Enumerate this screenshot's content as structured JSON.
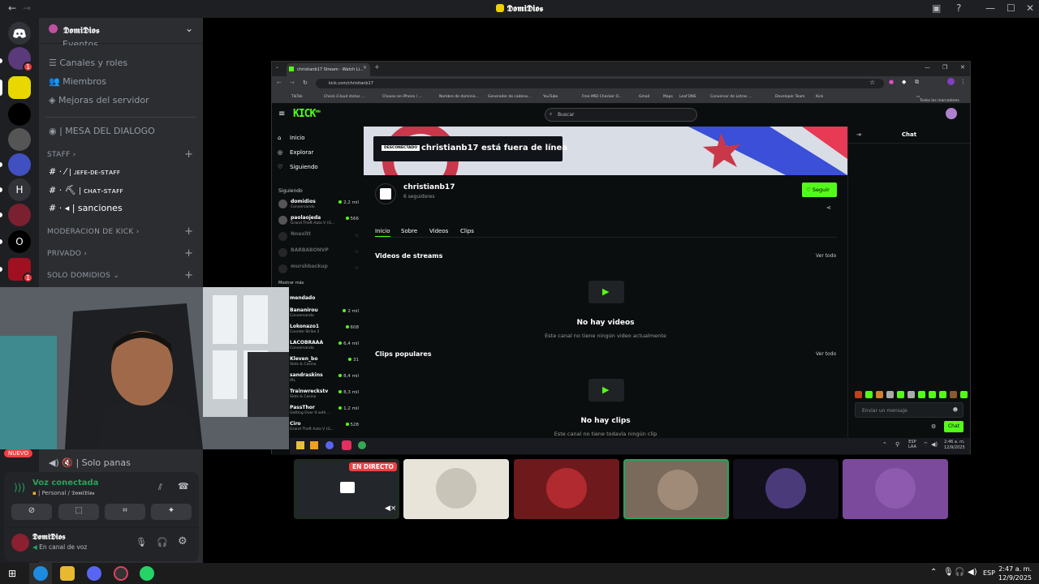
{
  "window": {
    "title": "𝕯𝖔𝖒𝖎𝕯𝖎𝖔𝖘"
  },
  "guild": {
    "name": "𝕯𝖔𝖒𝖎𝕯𝖎𝖔𝖘"
  },
  "channels": {
    "events": "Eventos",
    "roles": "Canales y roles",
    "members": "Miembros",
    "improve": "Mejoras del servidor",
    "mesa": "| MESA DEL DIALOGO",
    "cat_staff": "STAFF",
    "jefe": "| ᴊᴇꜰᴇ-ᴅᴇ-ꜱᴛᴀꜰꜰ",
    "chatstaff": "| ᴄʜᴀᴛ-ꜱᴛᴀꜰꜰ",
    "sanciones": "| sanciones",
    "cat_mod": "MODERACION DE KICK",
    "cat_priv": "PRIVADO",
    "cat_solo": "SOLO DOMIDIOS",
    "nuevo": "NUEVO",
    "solo_panas": "| Solo panas"
  },
  "servers": {
    "h": "H",
    "o": "O",
    "badge": "1"
  },
  "voice": {
    "status": "Voz conectada",
    "channel": "| Personal / 𝕯𝖔𝖒𝖎𝕯𝖎𝖔𝖘"
  },
  "user": {
    "name": "𝕯𝖔𝖒𝖎𝕯𝖎𝖔𝖘",
    "status": "En canal de voz"
  },
  "browser": {
    "tab": "christianb17 Stream - Watch Li...",
    "url": "kick.com/christianb17",
    "bookmarks": [
      "TikTok",
      "Check iCloud status ...",
      "Choose an iPhone / ...",
      "Nombre de dominio...",
      "Generador de cadena...",
      "YouTube",
      "Free IMEI Checker O...",
      "Gmail",
      "Maps",
      "Leaf DNS",
      "Conversor de Letras ...",
      "Developer Team",
      "Kick"
    ],
    "all_bookmarks": "Todos los marcadores"
  },
  "kick": {
    "logo": "KICK",
    "beta": "beta",
    "search": "Buscar",
    "nav": {
      "home": "Inicio",
      "explore": "Explorar",
      "following": "Siguiendo"
    },
    "following_header": "Siguiendo",
    "show_more": "Mostrar más",
    "recommended": "mendado",
    "followed": [
      {
        "name": "domidios",
        "game": "Conversando",
        "viewers": "2,2 mil",
        "live": true
      },
      {
        "name": "paolaojeda",
        "game": "Grand Theft Auto V (G...",
        "viewers": "566",
        "live": true
      },
      {
        "name": "Nnaxitt",
        "game": "",
        "viewers": "",
        "live": false
      },
      {
        "name": "BARBABONVP",
        "game": "",
        "viewers": "",
        "live": false
      },
      {
        "name": "murshbackup",
        "game": "",
        "viewers": "",
        "live": false
      }
    ],
    "recommended_list": [
      {
        "name": "Bananirou",
        "game": "Conversando",
        "viewers": "2 mil"
      },
      {
        "name": "Lokonazo1",
        "game": "Counter-Strike 2",
        "viewers": "608"
      },
      {
        "name": "LACOBRAAA",
        "game": "Conversando",
        "viewers": "6,4 mil"
      },
      {
        "name": "Kleven_bo",
        "game": "Slots & Casino",
        "viewers": "31"
      },
      {
        "name": "sandraskins",
        "game": "IRL",
        "viewers": "8,4 mil"
      },
      {
        "name": "Trainwreckstv",
        "game": "Slots & Casino",
        "viewers": "8,3 mil"
      },
      {
        "name": "PassThor",
        "game": "Getting Over It with ...",
        "viewers": "1,2 mil"
      },
      {
        "name": "Ciro",
        "game": "Grand Theft Auto V (G...",
        "viewers": "528"
      }
    ],
    "offline_badge": "DESCONECTADO",
    "offline_text": "christianb17 está fuera de línea",
    "channel": {
      "name": "christianb17",
      "followers": "6 seguidores",
      "follow": "Seguir"
    },
    "tabs": [
      "Inicio",
      "Sobre",
      "Videos",
      "Clips"
    ],
    "videos_title": "Videos de streams",
    "see_all": "Ver todo",
    "no_videos": "No hay videos",
    "no_videos_sub": "Este canal no tiene ningún video actualmente",
    "clips_title": "Clips populares",
    "no_clips": "No hay clips",
    "no_clips_sub": "Este canal no tiene todavía ningún clip",
    "chat_title": "Chat",
    "chat_placeholder": "Enviar un mensaje",
    "chat_button": "Chat"
  },
  "innertask": {
    "lang": "ESP",
    "lang2": "LAA",
    "time": "2:46 a. m.",
    "date": "12/9/2025"
  },
  "stream": {
    "live": "EN DIRECTO"
  },
  "taskbar": {
    "lang": "ESP",
    "time": "2:47 a. m.",
    "date": "12/9/2025"
  },
  "colors": {
    "kick_green": "#53fc18",
    "discord_bg": "#2b2d31",
    "discord_red": "#f23f43",
    "voice_green": "#23a55a"
  }
}
